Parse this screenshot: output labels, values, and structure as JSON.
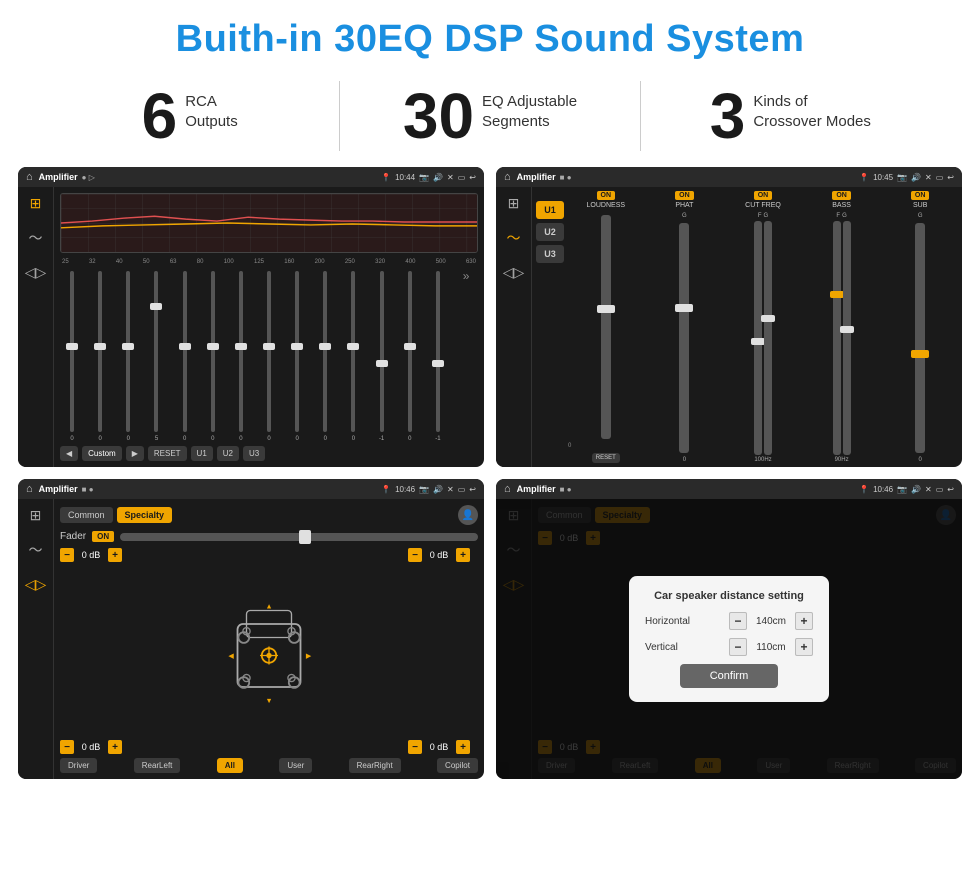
{
  "title": "Buith-in 30EQ DSP Sound System",
  "stats": [
    {
      "number": "6",
      "text": "RCA\nOutputs"
    },
    {
      "number": "30",
      "text": "EQ Adjustable\nSegments"
    },
    {
      "number": "3",
      "text": "Kinds of\nCrossover Modes"
    }
  ],
  "screen1": {
    "title": "Amplifier",
    "time": "10:44",
    "freqLabels": [
      "25",
      "32",
      "40",
      "50",
      "63",
      "80",
      "100",
      "125",
      "160",
      "200",
      "250",
      "320",
      "400",
      "500",
      "630"
    ],
    "sliderValues": [
      "0",
      "0",
      "0",
      "5",
      "0",
      "0",
      "0",
      "0",
      "0",
      "0",
      "0",
      "-1",
      "0",
      "-1"
    ],
    "buttons": [
      "Custom",
      "RESET",
      "U1",
      "U2",
      "U3"
    ]
  },
  "screen2": {
    "title": "Amplifier",
    "time": "10:45",
    "uButtons": [
      "U1",
      "U2",
      "U3"
    ],
    "controls": [
      {
        "label": "LOUDNESS",
        "on": true
      },
      {
        "label": "PHAT",
        "on": true
      },
      {
        "label": "CUT FREQ",
        "on": true
      },
      {
        "label": "BASS",
        "on": true
      },
      {
        "label": "SUB",
        "on": true
      }
    ]
  },
  "screen3": {
    "title": "Amplifier",
    "time": "10:46",
    "tabs": [
      "Common",
      "Specialty"
    ],
    "activeTab": "Specialty",
    "faderLabel": "Fader",
    "faderOn": "ON",
    "dbValues": {
      "topLeft": "0 dB",
      "topRight": "0 dB",
      "bottomLeft": "0 dB",
      "bottomRight": "0 dB"
    },
    "bottomBtns": [
      "Driver",
      "RearLeft",
      "All",
      "User",
      "RearRight",
      "Copilot"
    ]
  },
  "screen4": {
    "title": "Amplifier",
    "time": "10:46",
    "tabs": [
      "Common",
      "Specialty"
    ],
    "dialog": {
      "title": "Car speaker distance setting",
      "horizontal": "140cm",
      "vertical": "110cm",
      "confirmBtn": "Confirm"
    },
    "dbValues": {
      "topRight": "0 dB",
      "bottomRight": "0 dB"
    },
    "bottomBtns": [
      "Driver",
      "RearLeft",
      "All",
      "User",
      "RearRight",
      "Copilot"
    ]
  }
}
